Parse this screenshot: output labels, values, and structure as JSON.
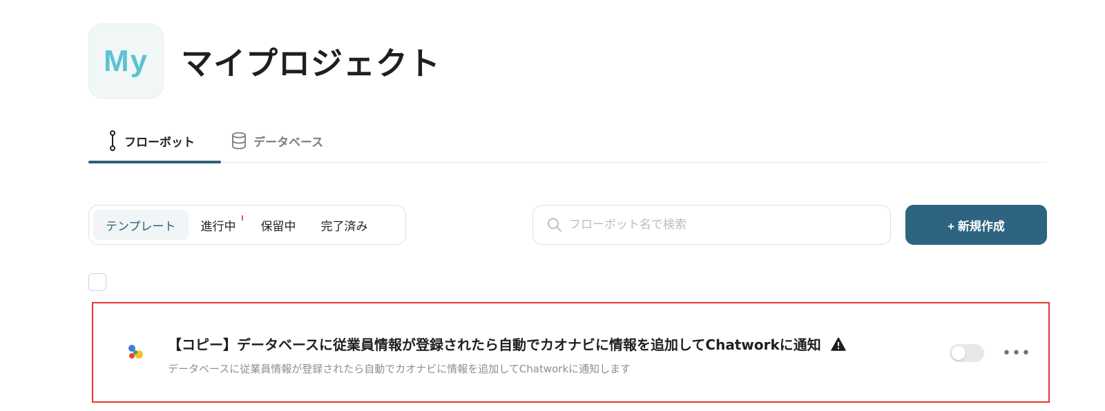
{
  "project": {
    "logo_text": "My",
    "title": "マイプロジェクト"
  },
  "tabs": [
    {
      "label": "フローボット",
      "icon": "flow-icon",
      "active": true
    },
    {
      "label": "データベース",
      "icon": "database-icon",
      "active": false
    }
  ],
  "filters": [
    {
      "label": "テンプレート",
      "active": true
    },
    {
      "label": "進行中",
      "active": false
    },
    {
      "label": "保留中",
      "active": false
    },
    {
      "label": "完了済み",
      "active": false
    }
  ],
  "search": {
    "placeholder": "フローボット名で検索"
  },
  "new_button": {
    "label": "+ 新規作成"
  },
  "flows": [
    {
      "title": "【コピー】データベースに従業員情報が登録されたら自動でカオナビに情報を追加してChatworkに通知",
      "description": "データベースに従業員情報が登録されたら自動でカオナビに情報を追加してChatworkに通知します",
      "warning": true,
      "enabled": false
    }
  ],
  "colors": {
    "accent": "#2e6480",
    "highlight_border": "#e1362b",
    "logo_text": "#5bc3d1"
  }
}
